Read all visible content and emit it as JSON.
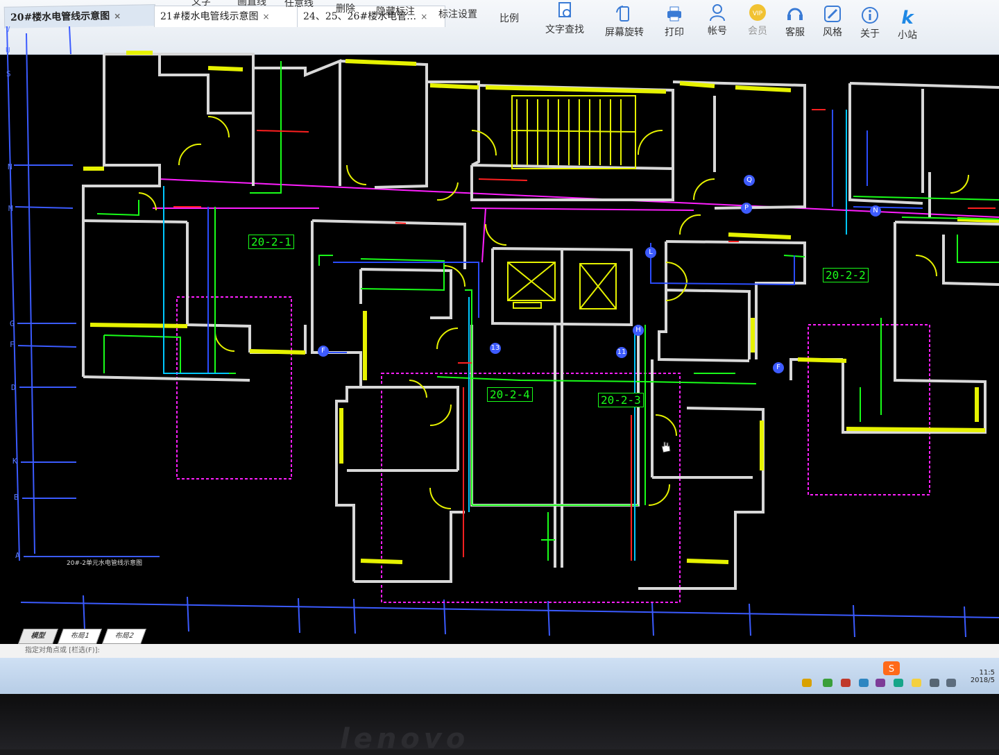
{
  "tabs": [
    {
      "label": "20#楼水电管线示意图",
      "close": "×",
      "active": true
    },
    {
      "label": "21#楼水电管线示意图",
      "close": "×",
      "active": false
    },
    {
      "label": "24、25、26#楼水电管…",
      "close": "×",
      "active": false
    }
  ],
  "toolbar": {
    "partial_labels": [
      "文字",
      "画直线",
      "任意线",
      "删除",
      "隐藏标注",
      "标注设置",
      "比例"
    ],
    "items": [
      {
        "label": "文字查找",
        "icon": "text-search-icon"
      },
      {
        "label": "屏幕旋转",
        "icon": "screen-rotate-icon"
      },
      {
        "label": "打印",
        "icon": "print-icon"
      },
      {
        "label": "帐号",
        "icon": "account-icon"
      },
      {
        "label": "会员",
        "icon": "vip-icon"
      },
      {
        "label": "客服",
        "icon": "headset-icon"
      },
      {
        "label": "风格",
        "icon": "style-icon"
      },
      {
        "label": "关于",
        "icon": "info-icon"
      },
      {
        "label": "小站",
        "icon": "k-station-icon"
      }
    ]
  },
  "drawing": {
    "unit_tags": [
      "20-2-1",
      "20-2-2",
      "20-2-4",
      "20-2-3"
    ],
    "left_axis_labels": [
      "V",
      "U",
      "S",
      "N",
      "M",
      "G",
      "F",
      "D",
      "K",
      "B",
      "A"
    ],
    "circle_labels": [
      "F",
      "13",
      "11",
      "Q",
      "P",
      "N",
      "L",
      "H",
      "F"
    ],
    "caption": "20#-2单元水电管线示意图"
  },
  "layout_tabs": [
    "模型",
    "布局1",
    "布局2"
  ],
  "command_line": "指定对角点或 [栏选(F)]:",
  "taskbar": {
    "time": "11:5",
    "date": "2018/5"
  },
  "brand": "lenovo",
  "colors": {
    "wall": "#d8d8d8",
    "window": "#e6f200",
    "pipe_magenta": "#ff1fff",
    "pipe_green": "#19ff19",
    "pipe_blue": "#2b4dff",
    "pipe_red": "#ff2020",
    "grid_axis": "#3b5bff",
    "tag_green": "#19ff19"
  }
}
